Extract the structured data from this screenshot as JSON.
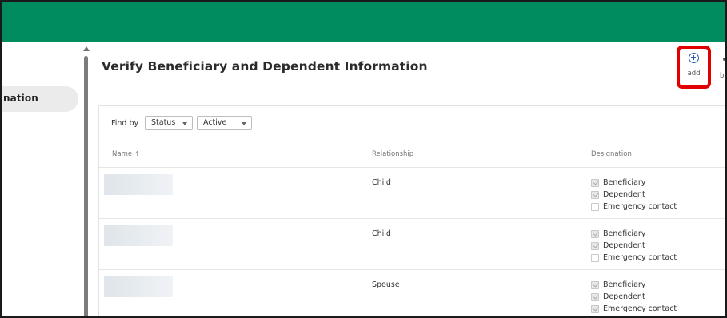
{
  "colors": {
    "top_bar": "#008c5f",
    "highlight": "#e00000",
    "add_icon": "#2a5db0"
  },
  "sidebar": {
    "active_item_label": "nation"
  },
  "page": {
    "title": "Verify Beneficiary and Dependent Information"
  },
  "actions": {
    "add": {
      "label": "add",
      "icon": "add-circle-icon"
    },
    "next": {
      "label": "b"
    }
  },
  "filters": {
    "find_by_label": "Find by",
    "status": {
      "label": "Status",
      "icon": "chevron-down-icon"
    },
    "active": {
      "label": "Active",
      "icon": "chevron-down-icon"
    }
  },
  "table": {
    "columns": [
      "Name",
      "Relationship",
      "Designation"
    ],
    "name_sort_icon": "↑",
    "rows": [
      {
        "relationship": "Child",
        "designations": [
          {
            "label": "Beneficiary",
            "checked": true
          },
          {
            "label": "Dependent",
            "checked": true
          },
          {
            "label": "Emergency contact",
            "checked": false
          }
        ]
      },
      {
        "relationship": "Child",
        "designations": [
          {
            "label": "Beneficiary",
            "checked": true
          },
          {
            "label": "Dependent",
            "checked": true
          },
          {
            "label": "Emergency contact",
            "checked": false
          }
        ]
      },
      {
        "relationship": "Spouse",
        "designations": [
          {
            "label": "Beneficiary",
            "checked": true
          },
          {
            "label": "Dependent",
            "checked": true
          },
          {
            "label": "Emergency contact",
            "checked": true
          }
        ]
      }
    ]
  }
}
